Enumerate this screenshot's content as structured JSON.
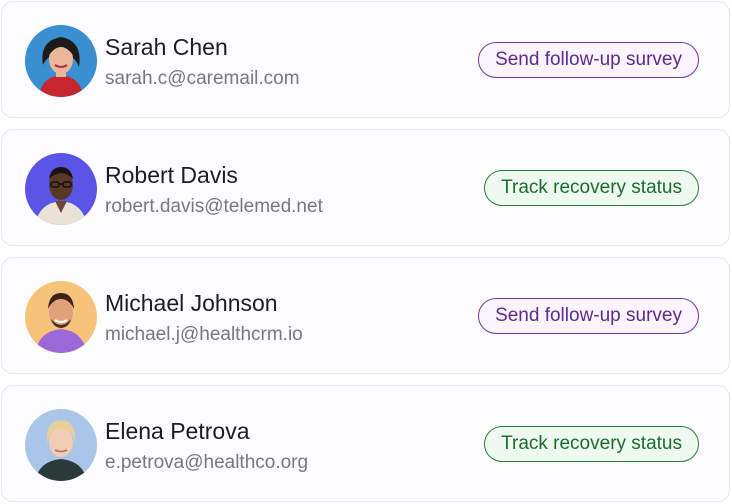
{
  "contacts": [
    {
      "name": "Sarah Chen",
      "email": "sarah.c@caremail.com",
      "action": "Send follow-up survey",
      "action_color": "#6b3d9b",
      "avatar_bg": "#3a8fd1"
    },
    {
      "name": "Robert Davis",
      "email": "robert.davis@telemed.net",
      "action": "Track recovery status",
      "action_color": "#2f7a3f",
      "avatar_bg": "#5a55e6"
    },
    {
      "name": "Michael Johnson",
      "email": "michael.j@healthcrm.io",
      "action": "Send follow-up survey",
      "action_color": "#6b3d9b",
      "avatar_bg": "#f7c37a"
    },
    {
      "name": "Elena Petrova",
      "email": "e.petrova@healthco.org",
      "action": "Track recovery status",
      "action_color": "#2f7a3f",
      "avatar_bg": "#a9c6e8"
    }
  ]
}
